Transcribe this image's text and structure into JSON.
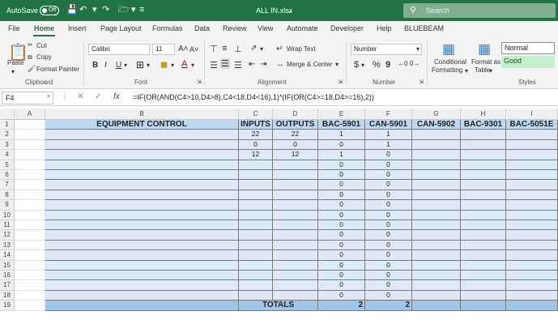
{
  "titlebar": {
    "autosave_label": "AutoSave",
    "autosave_state": "Off",
    "filename": "ALL IN.xlsx",
    "search_placeholder": "Search"
  },
  "tabs": [
    "File",
    "Home",
    "Insert",
    "Page Layout",
    "Formulas",
    "Data",
    "Review",
    "View",
    "Automate",
    "Developer",
    "Help",
    "BLUEBEAM"
  ],
  "active_tab": "Home",
  "ribbon": {
    "clipboard": {
      "paste": "Paste",
      "cut": "Cut",
      "copy": "Copy",
      "format_painter": "Format Painter",
      "label": "Clipboard"
    },
    "font": {
      "name": "Calibri",
      "size": "11",
      "bold": "B",
      "italic": "I",
      "underline": "U",
      "label": "Font"
    },
    "alignment": {
      "wrap": "Wrap Text",
      "merge": "Merge & Center",
      "label": "Alignment"
    },
    "number": {
      "format": "Number",
      "dollar": "$",
      "percent": "%",
      "comma": "9",
      "label": "Number"
    },
    "styles": {
      "conditional": "Conditional",
      "conditional2": "Formatting",
      "format_as": "Format as",
      "table": "Table",
      "normal": "Normal",
      "good": "Good",
      "label": "Styles"
    }
  },
  "formula_bar": {
    "cell_ref": "F4",
    "fx": "fx",
    "formula": "=IF(OR(AND(C4>10,D4>8),C4<18,D4<16),1)*(IF(OR(C4>=18,D4>=16),2))"
  },
  "columns": [
    "A",
    "B",
    "C",
    "D",
    "E",
    "F",
    "G",
    "H",
    "I"
  ],
  "sheet": {
    "headers": [
      "EQUIPMENT CONTROL",
      "INPUTS",
      "OUTPUTS",
      "BAC-5901",
      "CAN-5901",
      "CAN-5902",
      "BAC-9301",
      "BAC-5051E"
    ],
    "rows": [
      {
        "c": "22",
        "d": "22",
        "e": "1",
        "f": "1"
      },
      {
        "c": "0",
        "d": "0",
        "e": "0",
        "f": "1"
      },
      {
        "c": "12",
        "d": "12",
        "e": "1",
        "f": "0"
      },
      {
        "c": "",
        "d": "",
        "e": "0",
        "f": "0"
      },
      {
        "c": "",
        "d": "",
        "e": "0",
        "f": "0"
      },
      {
        "c": "",
        "d": "",
        "e": "0",
        "f": "0"
      },
      {
        "c": "",
        "d": "",
        "e": "0",
        "f": "0"
      },
      {
        "c": "",
        "d": "",
        "e": "0",
        "f": "0"
      },
      {
        "c": "",
        "d": "",
        "e": "0",
        "f": "0"
      },
      {
        "c": "",
        "d": "",
        "e": "0",
        "f": "0"
      },
      {
        "c": "",
        "d": "",
        "e": "0",
        "f": "0"
      },
      {
        "c": "",
        "d": "",
        "e": "0",
        "f": "0"
      },
      {
        "c": "",
        "d": "",
        "e": "0",
        "f": "0"
      },
      {
        "c": "",
        "d": "",
        "e": "0",
        "f": "0"
      },
      {
        "c": "",
        "d": "",
        "e": "0",
        "f": "0"
      },
      {
        "c": "",
        "d": "",
        "e": "0",
        "f": "0"
      },
      {
        "c": "",
        "d": "",
        "e": "0",
        "f": "0"
      }
    ],
    "totals_label": "TOTALS",
    "totals": {
      "e": "2",
      "f": "2"
    },
    "row_numbers": [
      "1",
      "2",
      "3",
      "4",
      "5",
      "6",
      "7",
      "8",
      "9",
      "10",
      "11",
      "12",
      "13",
      "14",
      "15",
      "16",
      "17",
      "18",
      "19"
    ]
  },
  "colors": {
    "excel_green": "#217346",
    "header_blue": "#bdd7ee",
    "body_blue": "#dde9f6",
    "totals_blue": "#9fc5e8",
    "good_fill": "#c6efce"
  }
}
